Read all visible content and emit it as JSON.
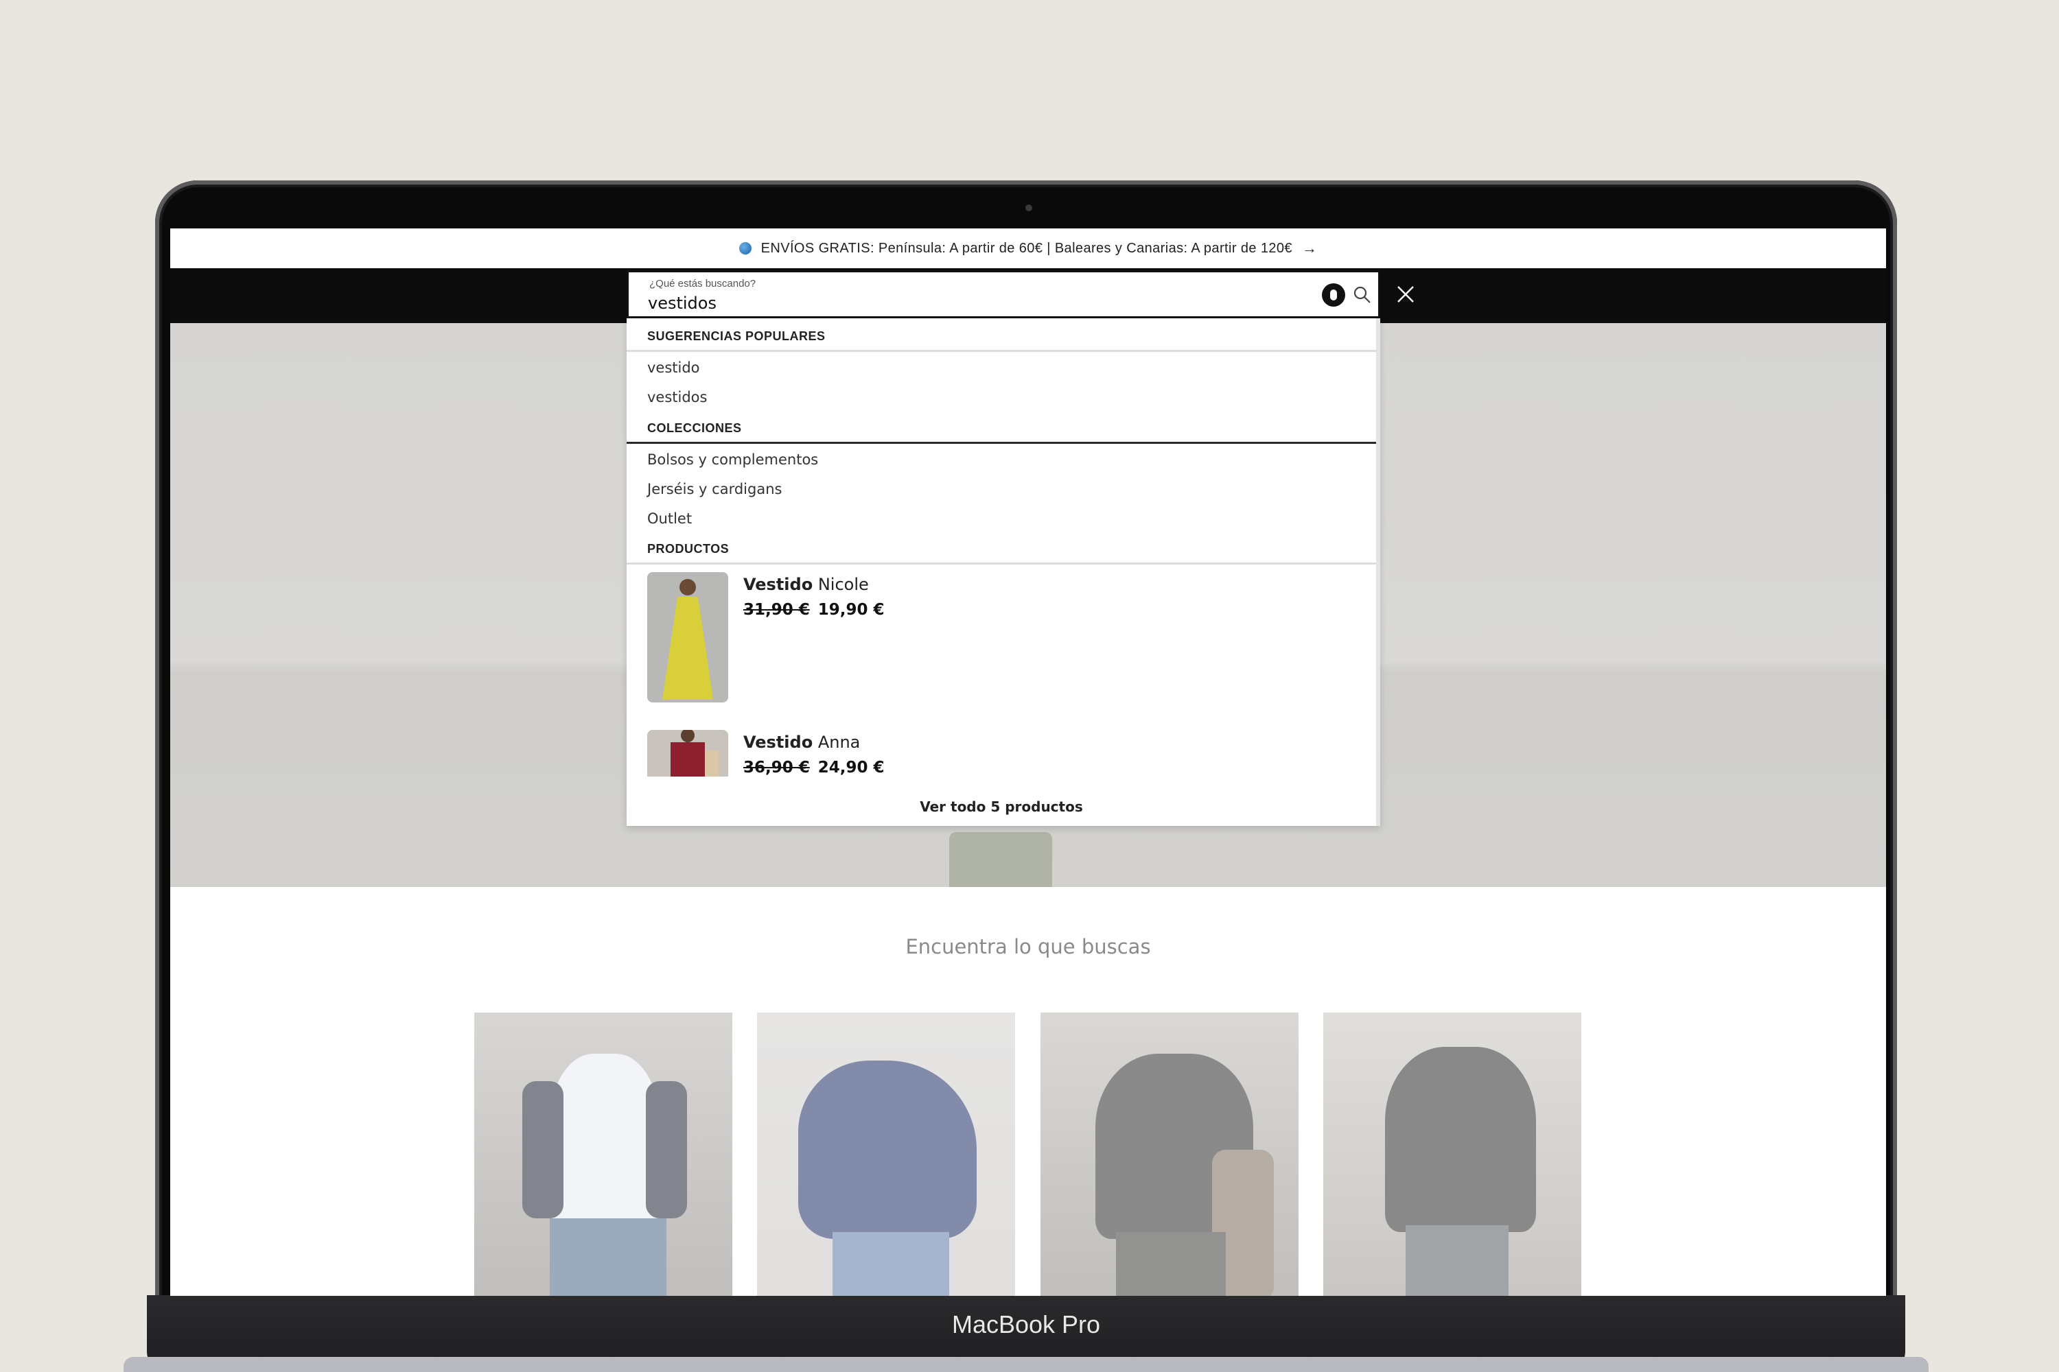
{
  "device": {
    "label": "MacBook Pro"
  },
  "announcement": {
    "text": "ENVÍOS GRATIS: Península: A partir de 60€ | Baleares y Canarias: A partir de 120€",
    "icon": "globe-icon"
  },
  "search": {
    "caption": "¿Qué estás buscando?",
    "value": "vestidos",
    "mic_icon": "microphone-icon",
    "search_icon": "search-icon",
    "close_icon": "close-icon"
  },
  "dropdown": {
    "suggestions_heading": "SUGERENCIAS POPULARES",
    "suggestions": [
      "vestido",
      "vestidos"
    ],
    "collections_heading": "COLECCIONES",
    "collections": [
      "Bolsos y complementos",
      "Jerséis y cardigans",
      "Outlet"
    ],
    "products_heading": "PRODUCTOS",
    "products": [
      {
        "name_bold": "Vestido",
        "name_rest": " Nicole",
        "old_price": "31,90 €",
        "price": "19,90 €"
      },
      {
        "name_bold": "Vestido",
        "name_rest": " Anna",
        "old_price": "36,90 €",
        "price": "24,90 €"
      }
    ],
    "view_all": "Ver todo 5 productos"
  },
  "main": {
    "section_title": "Encuentra lo que buscas"
  },
  "colors": {
    "background": "#e9e5df",
    "navbar": "#0c0c0c",
    "product1_dress": "#d9cf3a",
    "product2_top": "#8e1f2f"
  }
}
